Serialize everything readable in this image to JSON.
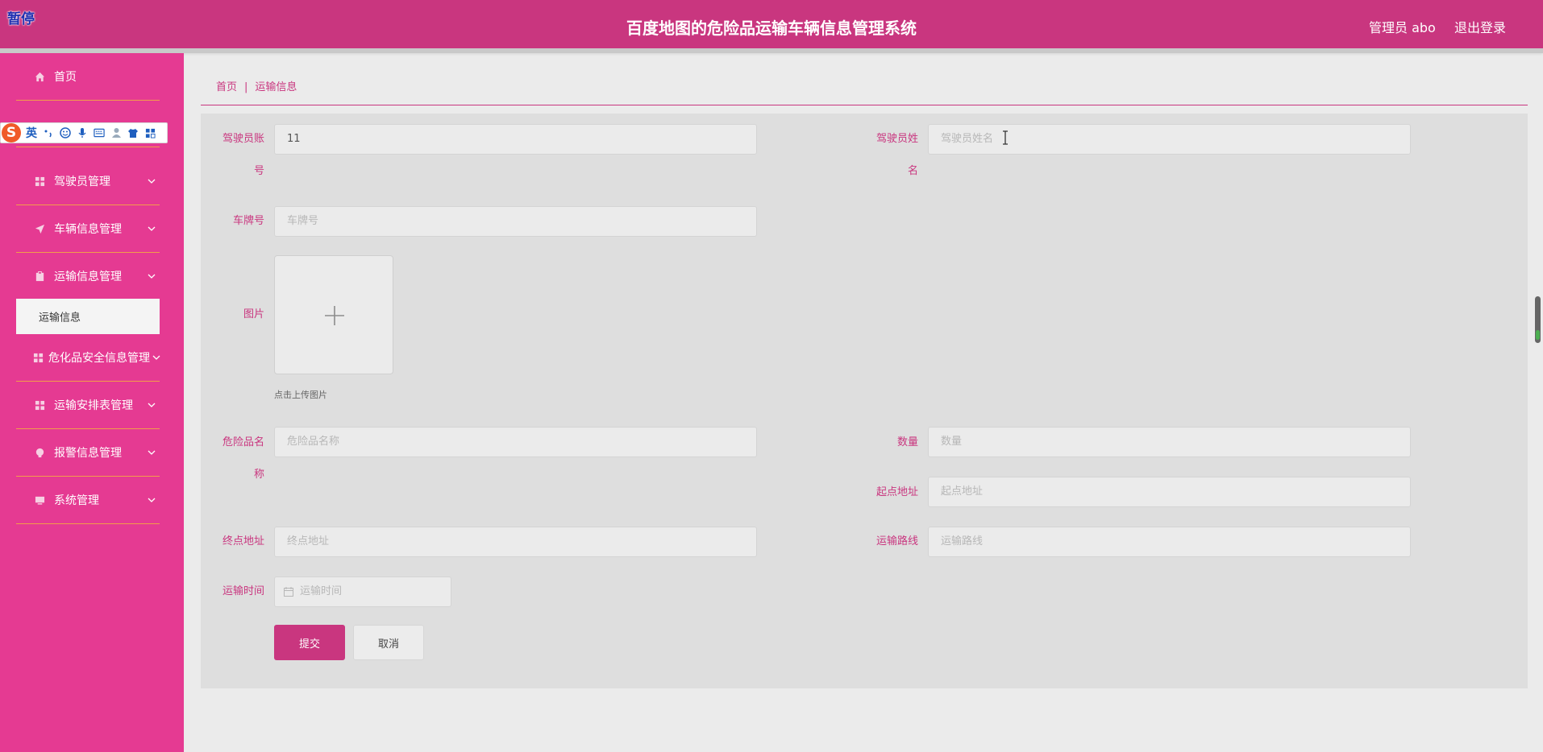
{
  "header": {
    "pause_badge": "暂停",
    "title": "百度地图的危险品运输车辆信息管理系统",
    "user": "管理员 abo",
    "logout": "退出登录",
    "color": "#c9367f"
  },
  "sidebar": {
    "color": "#e53a92",
    "home": "首页",
    "items": [
      {
        "label": "驾驶员管理",
        "icon": "grid-icon"
      },
      {
        "label": "车辆信息管理",
        "icon": "paper-plane-icon"
      },
      {
        "label": "运输信息管理",
        "icon": "clipboard-icon"
      },
      {
        "label": "危化品安全信息管理",
        "icon": "grid-icon"
      },
      {
        "label": "运输安排表管理",
        "icon": "grid-icon"
      },
      {
        "label": "报警信息管理",
        "icon": "bulb-icon"
      },
      {
        "label": "系统管理",
        "icon": "monitor-icon"
      }
    ],
    "sub_item": "运输信息"
  },
  "ime": {
    "logo": "S",
    "mode": "英"
  },
  "breadcrumb": {
    "home": "首页",
    "separator": "|",
    "current": "运输信息"
  },
  "form": {
    "driver_account": {
      "label_line1": "驾驶员账",
      "label_line2": "号",
      "value": "11"
    },
    "driver_name": {
      "label_line1": "驾驶员姓",
      "label_line2": "名",
      "placeholder": "驾驶员姓名"
    },
    "plate": {
      "label": "车牌号",
      "placeholder": "车牌号"
    },
    "image": {
      "label": "图片",
      "hint": "点击上传图片"
    },
    "hazard_name": {
      "label_line1": "危险品名",
      "label_line2": "称",
      "placeholder": "危险品名称"
    },
    "quantity": {
      "label": "数量",
      "placeholder": "数量"
    },
    "origin": {
      "label": "起点地址",
      "placeholder": "起点地址"
    },
    "destination": {
      "label": "终点地址",
      "placeholder": "终点地址"
    },
    "route": {
      "label": "运输路线",
      "placeholder": "运输路线"
    },
    "time": {
      "label": "运输时间",
      "placeholder": "运输时间"
    },
    "submit": "提交",
    "cancel": "取消"
  }
}
